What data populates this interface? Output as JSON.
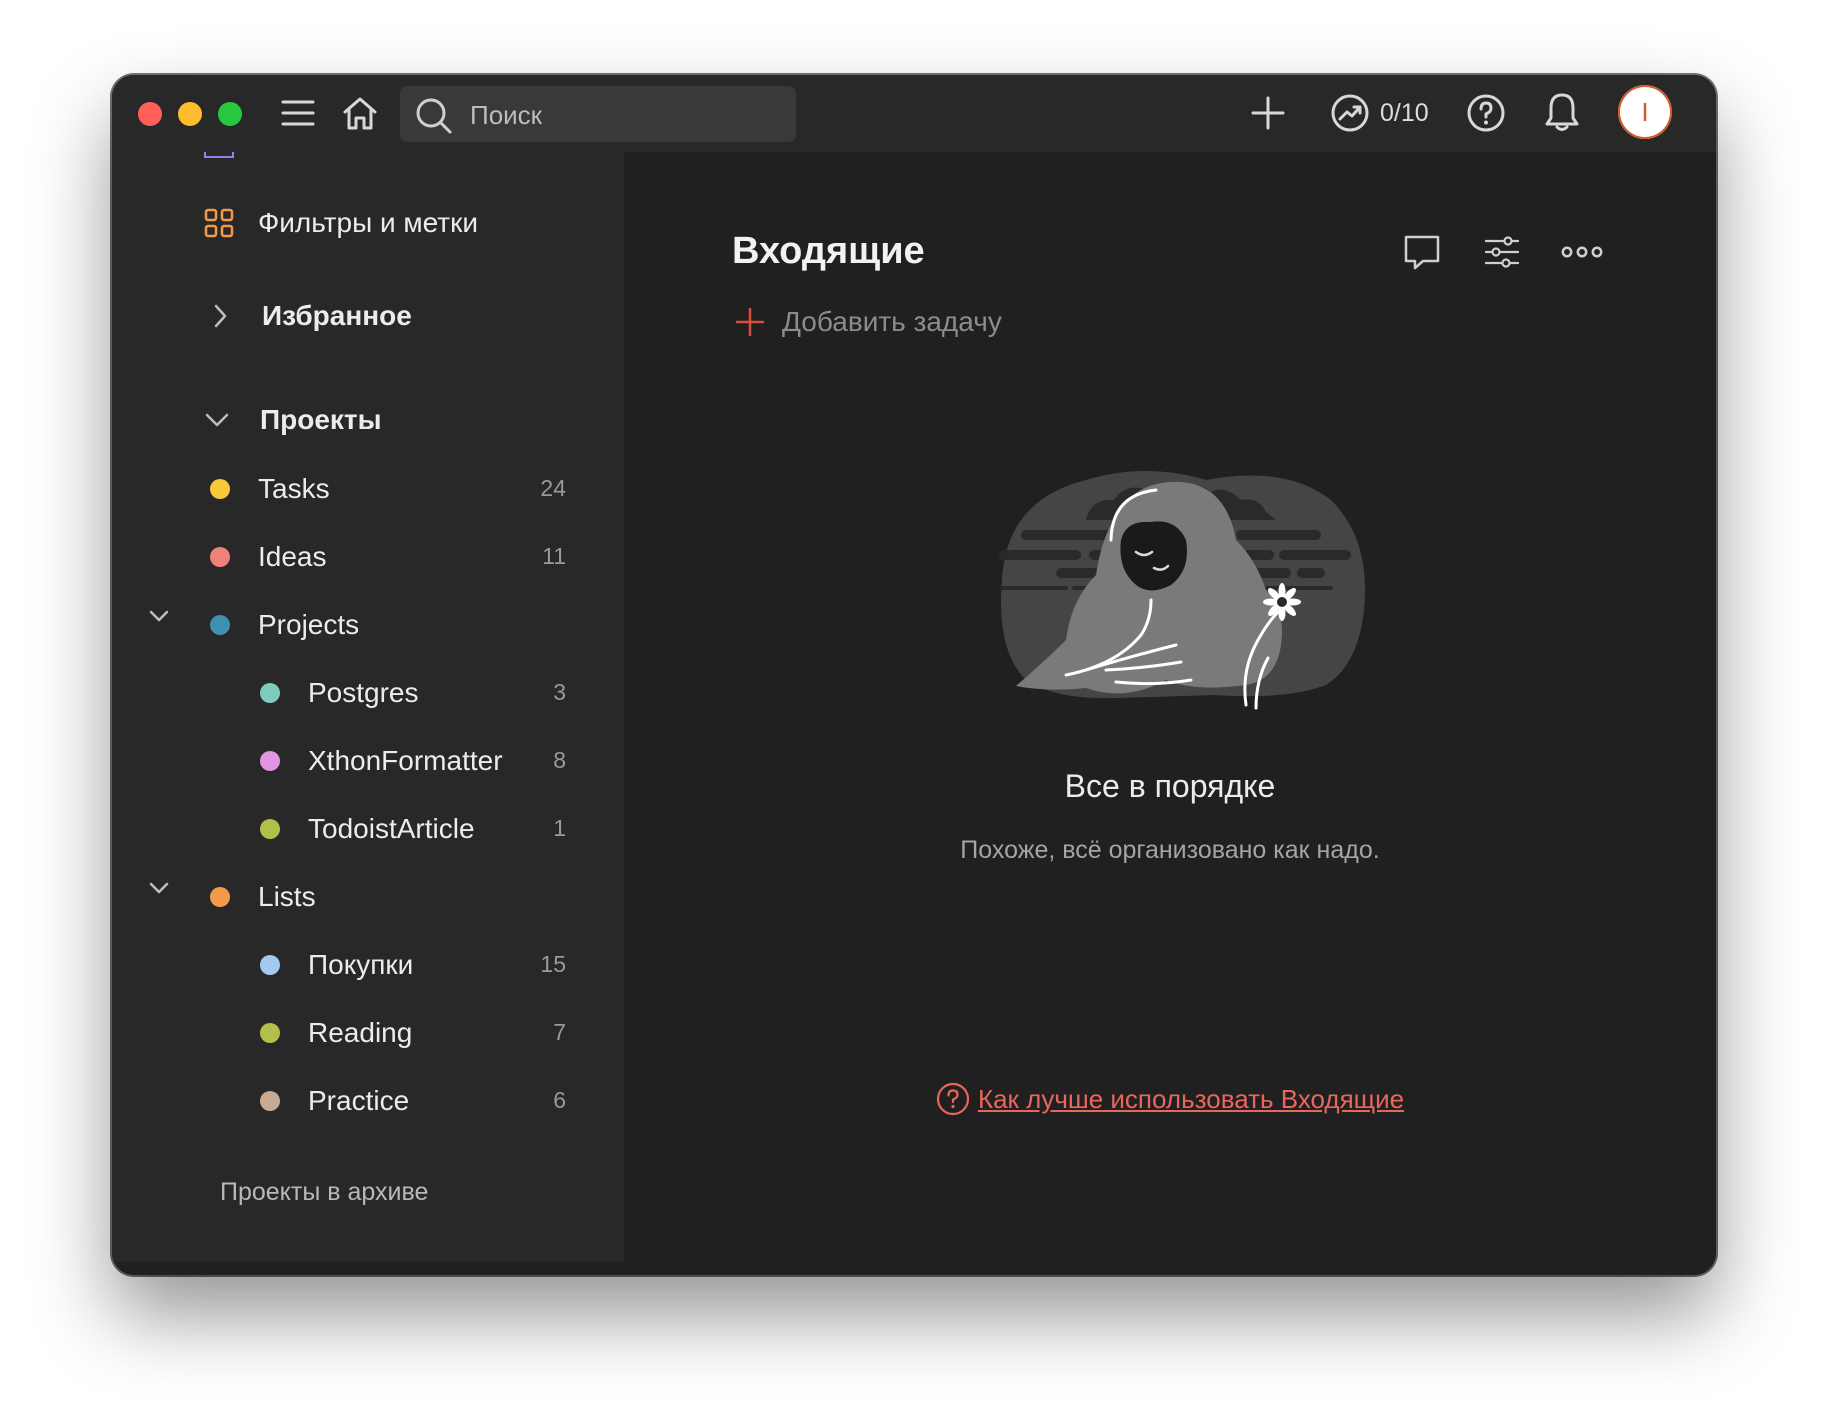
{
  "search": {
    "placeholder": "Поиск"
  },
  "header": {
    "karma": "0/10",
    "avatar_initial": "I"
  },
  "sidebar": {
    "filters_label": "Фильтры и метки",
    "favorites_label": "Избранное",
    "projects_label": "Проекты",
    "projects": [
      {
        "name": "Tasks",
        "count": "24",
        "color": "#f9c93a"
      },
      {
        "name": "Ideas",
        "count": "11",
        "color": "#f08279"
      },
      {
        "name": "Projects",
        "count": "",
        "color": "#3f8fb0"
      },
      {
        "name": "Postgres",
        "count": "3",
        "color": "#7ecbbf"
      },
      {
        "name": "XthonFormatter",
        "count": "8",
        "color": "#e495e2"
      },
      {
        "name": "TodoistArticle",
        "count": "1",
        "color": "#b2c04a"
      },
      {
        "name": "Lists",
        "count": "",
        "color": "#f39a4a"
      },
      {
        "name": "Покупки",
        "count": "15",
        "color": "#a5c8f0"
      },
      {
        "name": "Reading",
        "count": "7",
        "color": "#b2c04a"
      },
      {
        "name": "Practice",
        "count": "6",
        "color": "#c7aa91"
      }
    ],
    "archive_label": "Проекты в архиве"
  },
  "main": {
    "title": "Входящие",
    "add_task_label": "Добавить задачу",
    "empty_title": "Все в порядке",
    "empty_subtitle": "Похоже, всё организовано как надо.",
    "help_link": "Как лучше использовать Входящие"
  },
  "colors": {
    "accent": "#dc4c3e",
    "link": "#e8665b",
    "background": "#202020",
    "sidebar_background": "#282828"
  }
}
